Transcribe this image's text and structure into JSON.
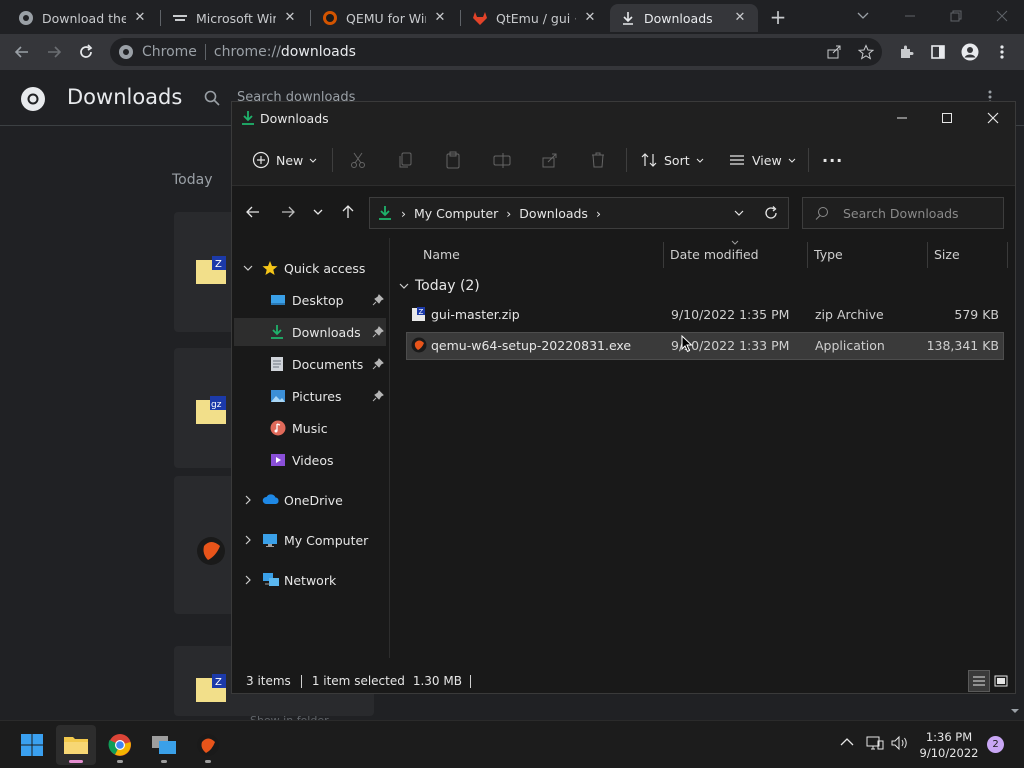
{
  "browser": {
    "tabs": [
      {
        "title": "Download the Fr",
        "icon": "chrome-icon"
      },
      {
        "title": "Microsoft Wind",
        "icon": "windows-logo-icon"
      },
      {
        "title": "QEMU for Wind",
        "icon": "qemu-icon"
      },
      {
        "title": "QtEmu / gui · Gi",
        "icon": "gitlab-icon"
      },
      {
        "title": "Downloads",
        "icon": "download-icon",
        "active": true
      }
    ],
    "omnibox": {
      "site_label": "Chrome",
      "url_prefix": "chrome://",
      "url_path": "downloads"
    }
  },
  "downloads_page": {
    "title": "Downloads",
    "search_placeholder": "Search downloads",
    "date_heading": "Today",
    "cut_text": "Show in folder"
  },
  "explorer": {
    "title": "Downloads",
    "commands": {
      "new": "New",
      "sort": "Sort",
      "view": "View",
      "more": "..."
    },
    "breadcrumb": [
      "My Computer",
      "Downloads"
    ],
    "search_placeholder": "Search Downloads",
    "nav": {
      "quick_access": "Quick access",
      "items": [
        {
          "label": "Desktop",
          "pinned": true
        },
        {
          "label": "Downloads",
          "pinned": true,
          "selected": true
        },
        {
          "label": "Documents",
          "pinned": true
        },
        {
          "label": "Pictures",
          "pinned": true
        },
        {
          "label": "Music",
          "pinned": false
        },
        {
          "label": "Videos",
          "pinned": false
        }
      ],
      "onedrive": "OneDrive",
      "my_computer": "My Computer",
      "network": "Network"
    },
    "columns": {
      "name": "Name",
      "date": "Date modified",
      "type": "Type",
      "size": "Size"
    },
    "group_label": "Today (2)",
    "files": [
      {
        "name": "gui-master.zip",
        "date": "9/10/2022 1:35 PM",
        "type": "zip Archive",
        "size": "579 KB",
        "selected": false
      },
      {
        "name": "qemu-w64-setup-20220831.exe",
        "date": "9/10/2022 1:33 PM",
        "type": "Application",
        "size": "138,341 KB",
        "selected": true
      }
    ],
    "status": {
      "items": "3 items",
      "selection": "1 item selected",
      "size": "1.30 MB"
    }
  },
  "taskbar": {
    "time": "1:36 PM",
    "date": "9/10/2022",
    "notification_count": "2"
  },
  "colors": {
    "accent": "#0078d4",
    "folder": "#f2c94c",
    "download_green": "#1fb26b"
  }
}
